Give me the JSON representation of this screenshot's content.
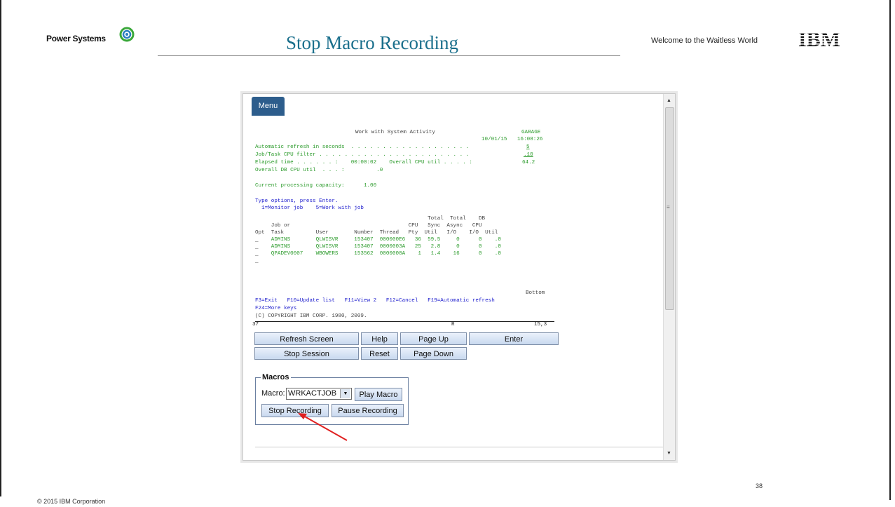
{
  "slide": {
    "brand": "Power Systems",
    "title": "Stop Macro Recording",
    "tagline": "Welcome to the Waitless World",
    "ibm_logo_text": "IBM",
    "copyright": "© 2015 IBM Corporation",
    "page_number": "38"
  },
  "browser": {
    "menu_label": "Menu"
  },
  "terminal": {
    "screen_title": "Work with System Activity",
    "system_name": "GARAGE",
    "date": "10/01/15",
    "time": "16:08:26",
    "line_refresh": "Automatic refresh in seconds  . . . . . . . . . . . . . . . . . . .",
    "refresh_value": "5",
    "line_filter": "Job/Task CPU filter . . . . . . . . . . . . . . . . . . . . . . . .",
    "filter_value": ".10",
    "line_elapsed": "Elapsed time . . . . . . :    00:00:02    Overall CPU util . . . . :",
    "overall_cpu": "64.2",
    "line_db_cpu": "Overall DB CPU util  . . . :          .0",
    "line_capacity": "Current processing capacity:      1.00",
    "line_type_options": "Type options, press Enter.",
    "line_options": "  1=Monitor job    5=Work with job",
    "header1": "                                                      Total  Total    DB",
    "header2": "     Job or                                     CPU   Sync  Async   CPU",
    "header3": "Opt  Task          User        Number  Thread   Pty  Util   I/O    I/O  Util",
    "rows": [
      "     ADMINS        QLWISVR     153407  000000E6   36  59.5     0      0    .0",
      "     ADMINS        QLWISVR     153407  0000003A   25   2.8     0      0    .0",
      "     QPADEV0007    WBOWERS     153562  0000000A    1   1.4    16      0    .0"
    ],
    "bottom_label": "Bottom",
    "fkeys1": "F3=Exit   F10=Update list   F11=View 2   F12=Cancel   F19=Automatic refresh",
    "fkeys2": "F24=More keys",
    "copyright_line": "(C) COPYRIGHT IBM CORP. 1980, 2009.",
    "status_left": "37",
    "status_mid": "R",
    "status_right": "15,3"
  },
  "controls": {
    "refresh_screen": "Refresh Screen",
    "help": "Help",
    "page_up": "Page Up",
    "enter": "Enter",
    "stop_session": "Stop Session",
    "reset": "Reset",
    "page_down": "Page Down"
  },
  "macros": {
    "legend": "Macros",
    "macro_label": "Macro:",
    "selected_macro": "WRKACTJOB",
    "play_macro": "Play Macro",
    "stop_recording": "Stop Recording",
    "pause_recording": "Pause Recording"
  },
  "colors": {
    "title": "#1a6f8c",
    "terminal_green": "#2a9a2a",
    "terminal_blue": "#1a1acc",
    "menu_button": "#2d5d8c",
    "arrow": "#e02020"
  }
}
